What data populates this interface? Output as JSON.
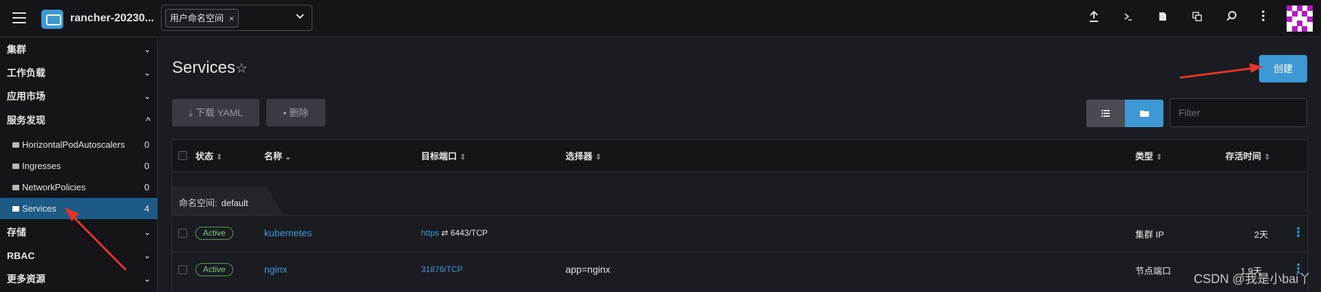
{
  "header": {
    "cluster_name": "rancher-20230...",
    "namespace_chip": "用户命名空间",
    "chip_close": "×",
    "chevron": "⌄",
    "icons": [
      "upload-icon",
      "terminal-icon",
      "file-icon",
      "copy-icon",
      "search-icon",
      "more-vertical-icon"
    ]
  },
  "sidebar": {
    "groups": [
      {
        "label": "集群",
        "chevron": "⌄"
      },
      {
        "label": "工作负载",
        "chevron": "⌄"
      },
      {
        "label": "应用市场",
        "chevron": "⌄"
      },
      {
        "label": "服务发现",
        "chevron": "^"
      },
      {
        "label": "存储",
        "chevron": "⌄"
      },
      {
        "label": "RBAC",
        "chevron": "⌄"
      },
      {
        "label": "更多资源",
        "chevron": "⌄"
      }
    ],
    "items": [
      {
        "label": "HorizontalPodAutoscalers",
        "count": "0"
      },
      {
        "label": "Ingresses",
        "count": "0"
      },
      {
        "label": "NetworkPolicies",
        "count": "0"
      },
      {
        "label": "Services",
        "count": "4"
      }
    ]
  },
  "main": {
    "title": "Services",
    "create_label": "创建",
    "download_label": "下载 YAML",
    "delete_label": "删除",
    "filter_placeholder": "Filter",
    "columns": {
      "state": "状态",
      "name": "名称",
      "target_port": "目标端口",
      "selector": "选择器",
      "type": "类型",
      "age": "存活时间"
    },
    "group": {
      "prefix": "命名空间:",
      "name": "default"
    },
    "rows": [
      {
        "state": "Active",
        "name": "kubernetes",
        "port_link": "https",
        "port_value": "6443/TCP",
        "selector": "",
        "type": "集群 IP",
        "age": "2天"
      },
      {
        "state": "Active",
        "name": "nginx",
        "port_link": "31876/TCP",
        "port_value": "",
        "selector": "app=nginx",
        "type": "节点端口",
        "age": "1.9天"
      }
    ]
  },
  "watermark": "CSDN @我是小bai丫",
  "colors": {
    "accent": "#3d98d3",
    "active_green": "#7fcf7f",
    "annotation_red": "#e0362c",
    "avatar_magenta": "#b01bc4"
  }
}
